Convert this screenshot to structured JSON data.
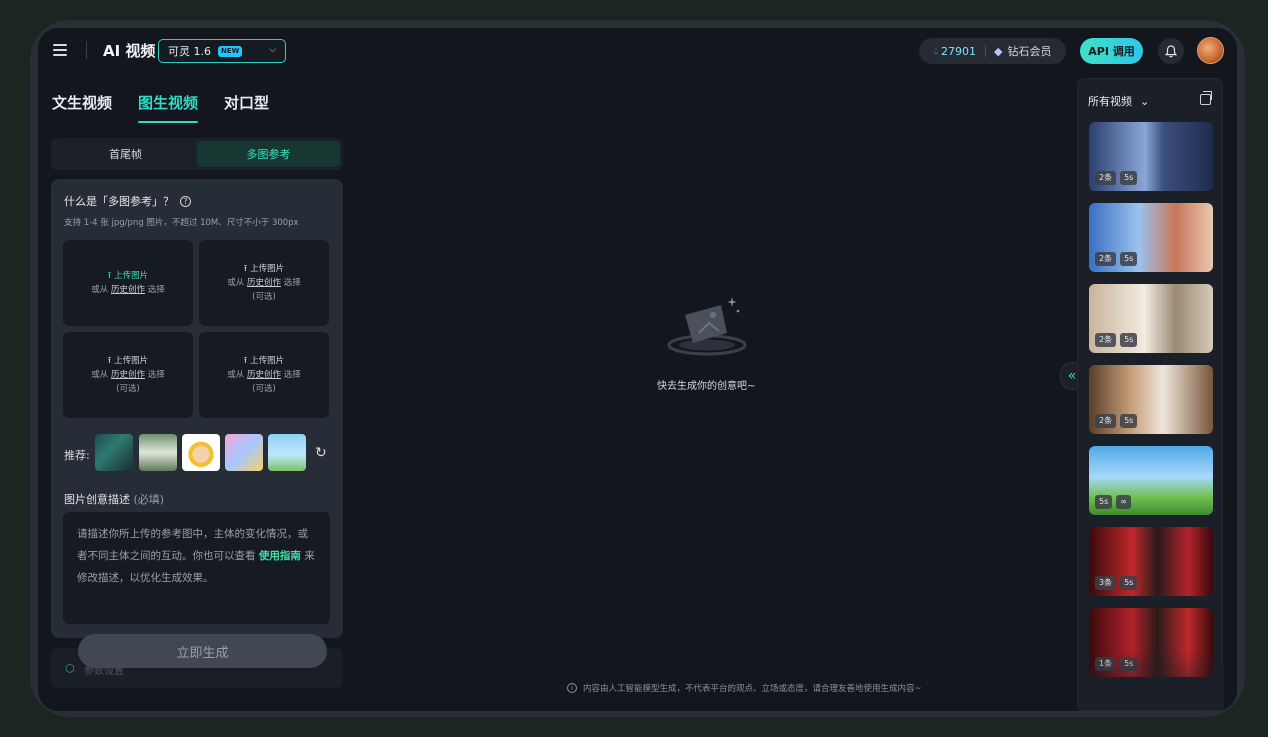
{
  "header": {
    "app_title": "AI 视频",
    "model": {
      "label": "可灵 1.6",
      "badge": "NEW"
    },
    "credits": {
      "amount": "27901",
      "membership": "钻石会员"
    },
    "api_label": "API 调用"
  },
  "mode_tabs": [
    {
      "label": "文生视频",
      "active": false
    },
    {
      "label": "图生视频",
      "active": true
    },
    {
      "label": "对口型",
      "active": false
    }
  ],
  "sub_tabs": [
    {
      "label": "首尾帧",
      "active": false
    },
    {
      "label": "多图参考",
      "active": true
    }
  ],
  "panel": {
    "title": "什么是「多图参考」？",
    "hint": "支持 1-4 张 jpg/png 图片，不超过 10M、尺寸不小于 300px",
    "upload_cells": [
      {
        "upload": "上传图片",
        "prefix": "或从",
        "link": "历史创作",
        "suffix": "选择",
        "optional": ""
      },
      {
        "upload": "上传图片",
        "prefix": "或从",
        "link": "历史创作",
        "suffix": "选择",
        "optional": "(可选)"
      },
      {
        "upload": "上传图片",
        "prefix": "或从",
        "link": "历史创作",
        "suffix": "选择",
        "optional": "(可选)"
      },
      {
        "upload": "上传图片",
        "prefix": "或从",
        "link": "历史创作",
        "suffix": "选择",
        "optional": "(可选)"
      }
    ],
    "recommend_label": "推荐:",
    "description": {
      "label": "图片创意描述",
      "required": "(必填)",
      "placeholder_start": "请描述你所上传的参考图中，主体的变化情况，或者不同主体之间的互动。你也可以查看",
      "guide_link": "使用指南",
      "placeholder_end": "来修改描述，以优化生成效果。"
    },
    "generate_label": "立即生成",
    "params_label": "参数设置"
  },
  "center": {
    "empty_text": "快去生成你的创意吧~",
    "disclaimer": "内容由人工智能模型生成，不代表平台的观点、立场或态度，请合理友善地使用生成内容~"
  },
  "sidebar": {
    "title": "所有视频",
    "videos": [
      {
        "count": "2条",
        "duration": "5s"
      },
      {
        "count": "2条",
        "duration": "5s"
      },
      {
        "count": "2条",
        "duration": "5s"
      },
      {
        "count": "2条",
        "duration": "5s"
      },
      {
        "count": "",
        "duration": "5s"
      },
      {
        "count": "3条",
        "duration": "5s"
      },
      {
        "count": "1条",
        "duration": "5s"
      }
    ]
  },
  "colors": {
    "accent": "#35d9c6",
    "link_green": "#3ee0a9",
    "background": "#13161d"
  }
}
